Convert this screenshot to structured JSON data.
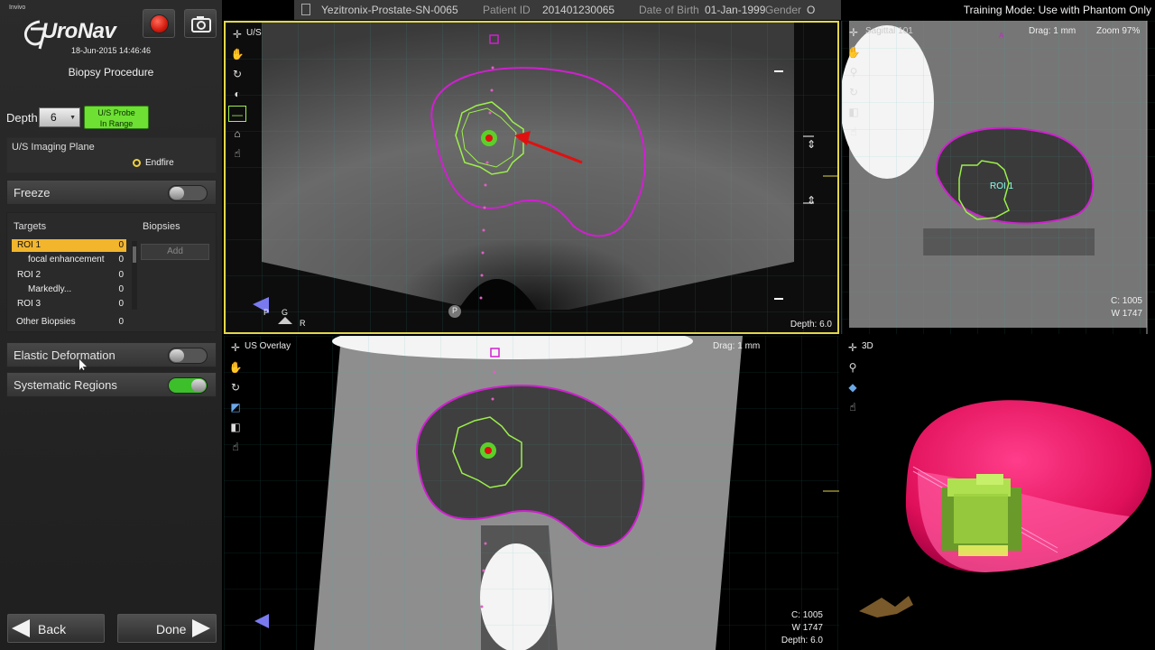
{
  "brand": {
    "small": "Invivo",
    "name": "UroNav"
  },
  "header": {
    "datetime": "18-Jun-2015 14:46:46",
    "procedure": "Biopsy Procedure"
  },
  "depth": {
    "label": "Depth",
    "value": "6"
  },
  "probe_status": {
    "line1": "U/S Probe",
    "line2": "In Range",
    "color": "#6ee034"
  },
  "imaging_plane": {
    "title": "U/S Imaging Plane",
    "option": "Endfire"
  },
  "freeze": {
    "label": "Freeze",
    "on": false
  },
  "targets": {
    "header_targets": "Targets",
    "header_biopsies": "Biopsies",
    "add_label": "Add",
    "rows": [
      {
        "name": "ROI 1",
        "count": "0",
        "selected": true,
        "sub": false
      },
      {
        "name": "focal enhancement",
        "count": "0",
        "selected": false,
        "sub": true
      },
      {
        "name": "ROI 2",
        "count": "0",
        "selected": false,
        "sub": false
      },
      {
        "name": "Markedly...",
        "count": "0",
        "selected": false,
        "sub": true
      },
      {
        "name": "ROI 3",
        "count": "0",
        "selected": false,
        "sub": false
      }
    ],
    "other": {
      "name": "Other Biopsies",
      "count": "0"
    }
  },
  "elastic_deformation": {
    "label": "Elastic Deformation",
    "on": false
  },
  "systematic_regions": {
    "label": "Systematic Regions",
    "on": true
  },
  "nav": {
    "back": "Back",
    "done": "Done"
  },
  "patient_bar": {
    "name": "Yezitronix-Prostate-SN-0065",
    "patient_id_label": "Patient ID",
    "patient_id": "201401230065",
    "dob_label": "Date of Birth",
    "dob": "01-Jan-1999",
    "gender_label": "Gender",
    "gender": "O"
  },
  "training_mode": "Training Mode: Use with Phantom Only",
  "viewports": {
    "us": {
      "label": "U/S",
      "depth": "Depth: 6.0",
      "orient_p": "P",
      "orient_g": "G",
      "orient_r": "R",
      "marker": "P"
    },
    "sagittal": {
      "label": "Sagittal 101",
      "drag": "Drag: 1 mm",
      "zoom": "Zoom 97%",
      "c": "C: 1005",
      "w": "W 1747",
      "a_mark": "A",
      "roi_label": "ROI 1"
    },
    "overlay": {
      "label": "US Overlay",
      "drag": "Drag: 1 mm",
      "c": "C: 1005",
      "w": "W 1747",
      "depth": "Depth: 6.0"
    },
    "three_d": {
      "label": "3D"
    }
  },
  "colors": {
    "prostate_contour": "#d020d0",
    "roi": "#9cf04a",
    "target": "#e01010",
    "viewport_highlight": "#e2d64a",
    "selected_row": "#f2b52c"
  }
}
